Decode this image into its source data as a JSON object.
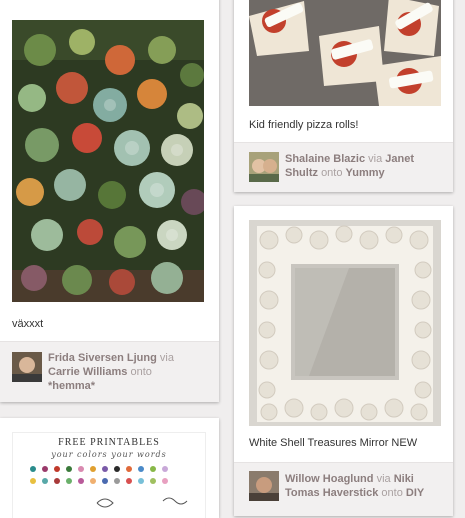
{
  "pins": [
    {
      "description": "växxxt",
      "pinner": "Frida Siversen Ljung",
      "via_word": "via",
      "source": "Carrie Williams",
      "onto_word": "onto",
      "board": "*hemma*"
    },
    {
      "description": "Kid friendly pizza rolls!",
      "pinner": "Shalaine Blazic",
      "via_word": "via",
      "source": "Janet Shultz",
      "onto_word": "onto",
      "board": "Yummy"
    },
    {
      "description": "White Shell Treasures Mirror NEW",
      "pinner": "Willow Hoaglund",
      "via_word": "via",
      "source": "Niki Tomas Haverstick",
      "onto_word": "onto",
      "board": "DIY"
    }
  ],
  "printables_card": {
    "title": "FREE PRINTABLES",
    "subtitle": "your colors your words"
  },
  "colors": {
    "background": "#f0eeee",
    "card": "#ffffff",
    "attribution_bg": "#f2f0f0",
    "link_text": "#8c7e7e",
    "muted_text": "#aaa1a1"
  }
}
